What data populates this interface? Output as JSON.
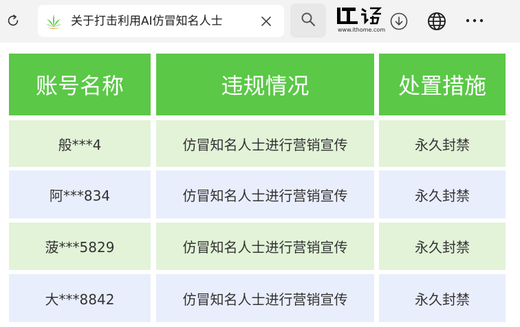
{
  "browser": {
    "tab_title": "关于打击利用AI仿冒知名人士",
    "logo_text": "IT之家",
    "logo_url": "www.ithome.com"
  },
  "table": {
    "headers": [
      "账号名称",
      "违规情况",
      "处置措施"
    ],
    "rows": [
      {
        "account": "般***4",
        "violation": "仿冒知名人士进行营销宣传",
        "action": "永久封禁"
      },
      {
        "account": "阿***834",
        "violation": "仿冒知名人士进行营销宣传",
        "action": "永久封禁"
      },
      {
        "account": "菠***5829",
        "violation": "仿冒知名人士进行营销宣传",
        "action": "永久封禁"
      },
      {
        "account": "大***8842",
        "violation": "仿冒知名人士进行营销宣传",
        "action": "永久封禁"
      }
    ]
  },
  "colors": {
    "header_bg": "#5bc847",
    "row_green": "#e2f3d8",
    "row_blue": "#e9eefc"
  },
  "icons": [
    "reload-icon",
    "site-favicon-icon",
    "close-icon",
    "search-icon",
    "download-icon",
    "globe-icon",
    "more-icon"
  ]
}
